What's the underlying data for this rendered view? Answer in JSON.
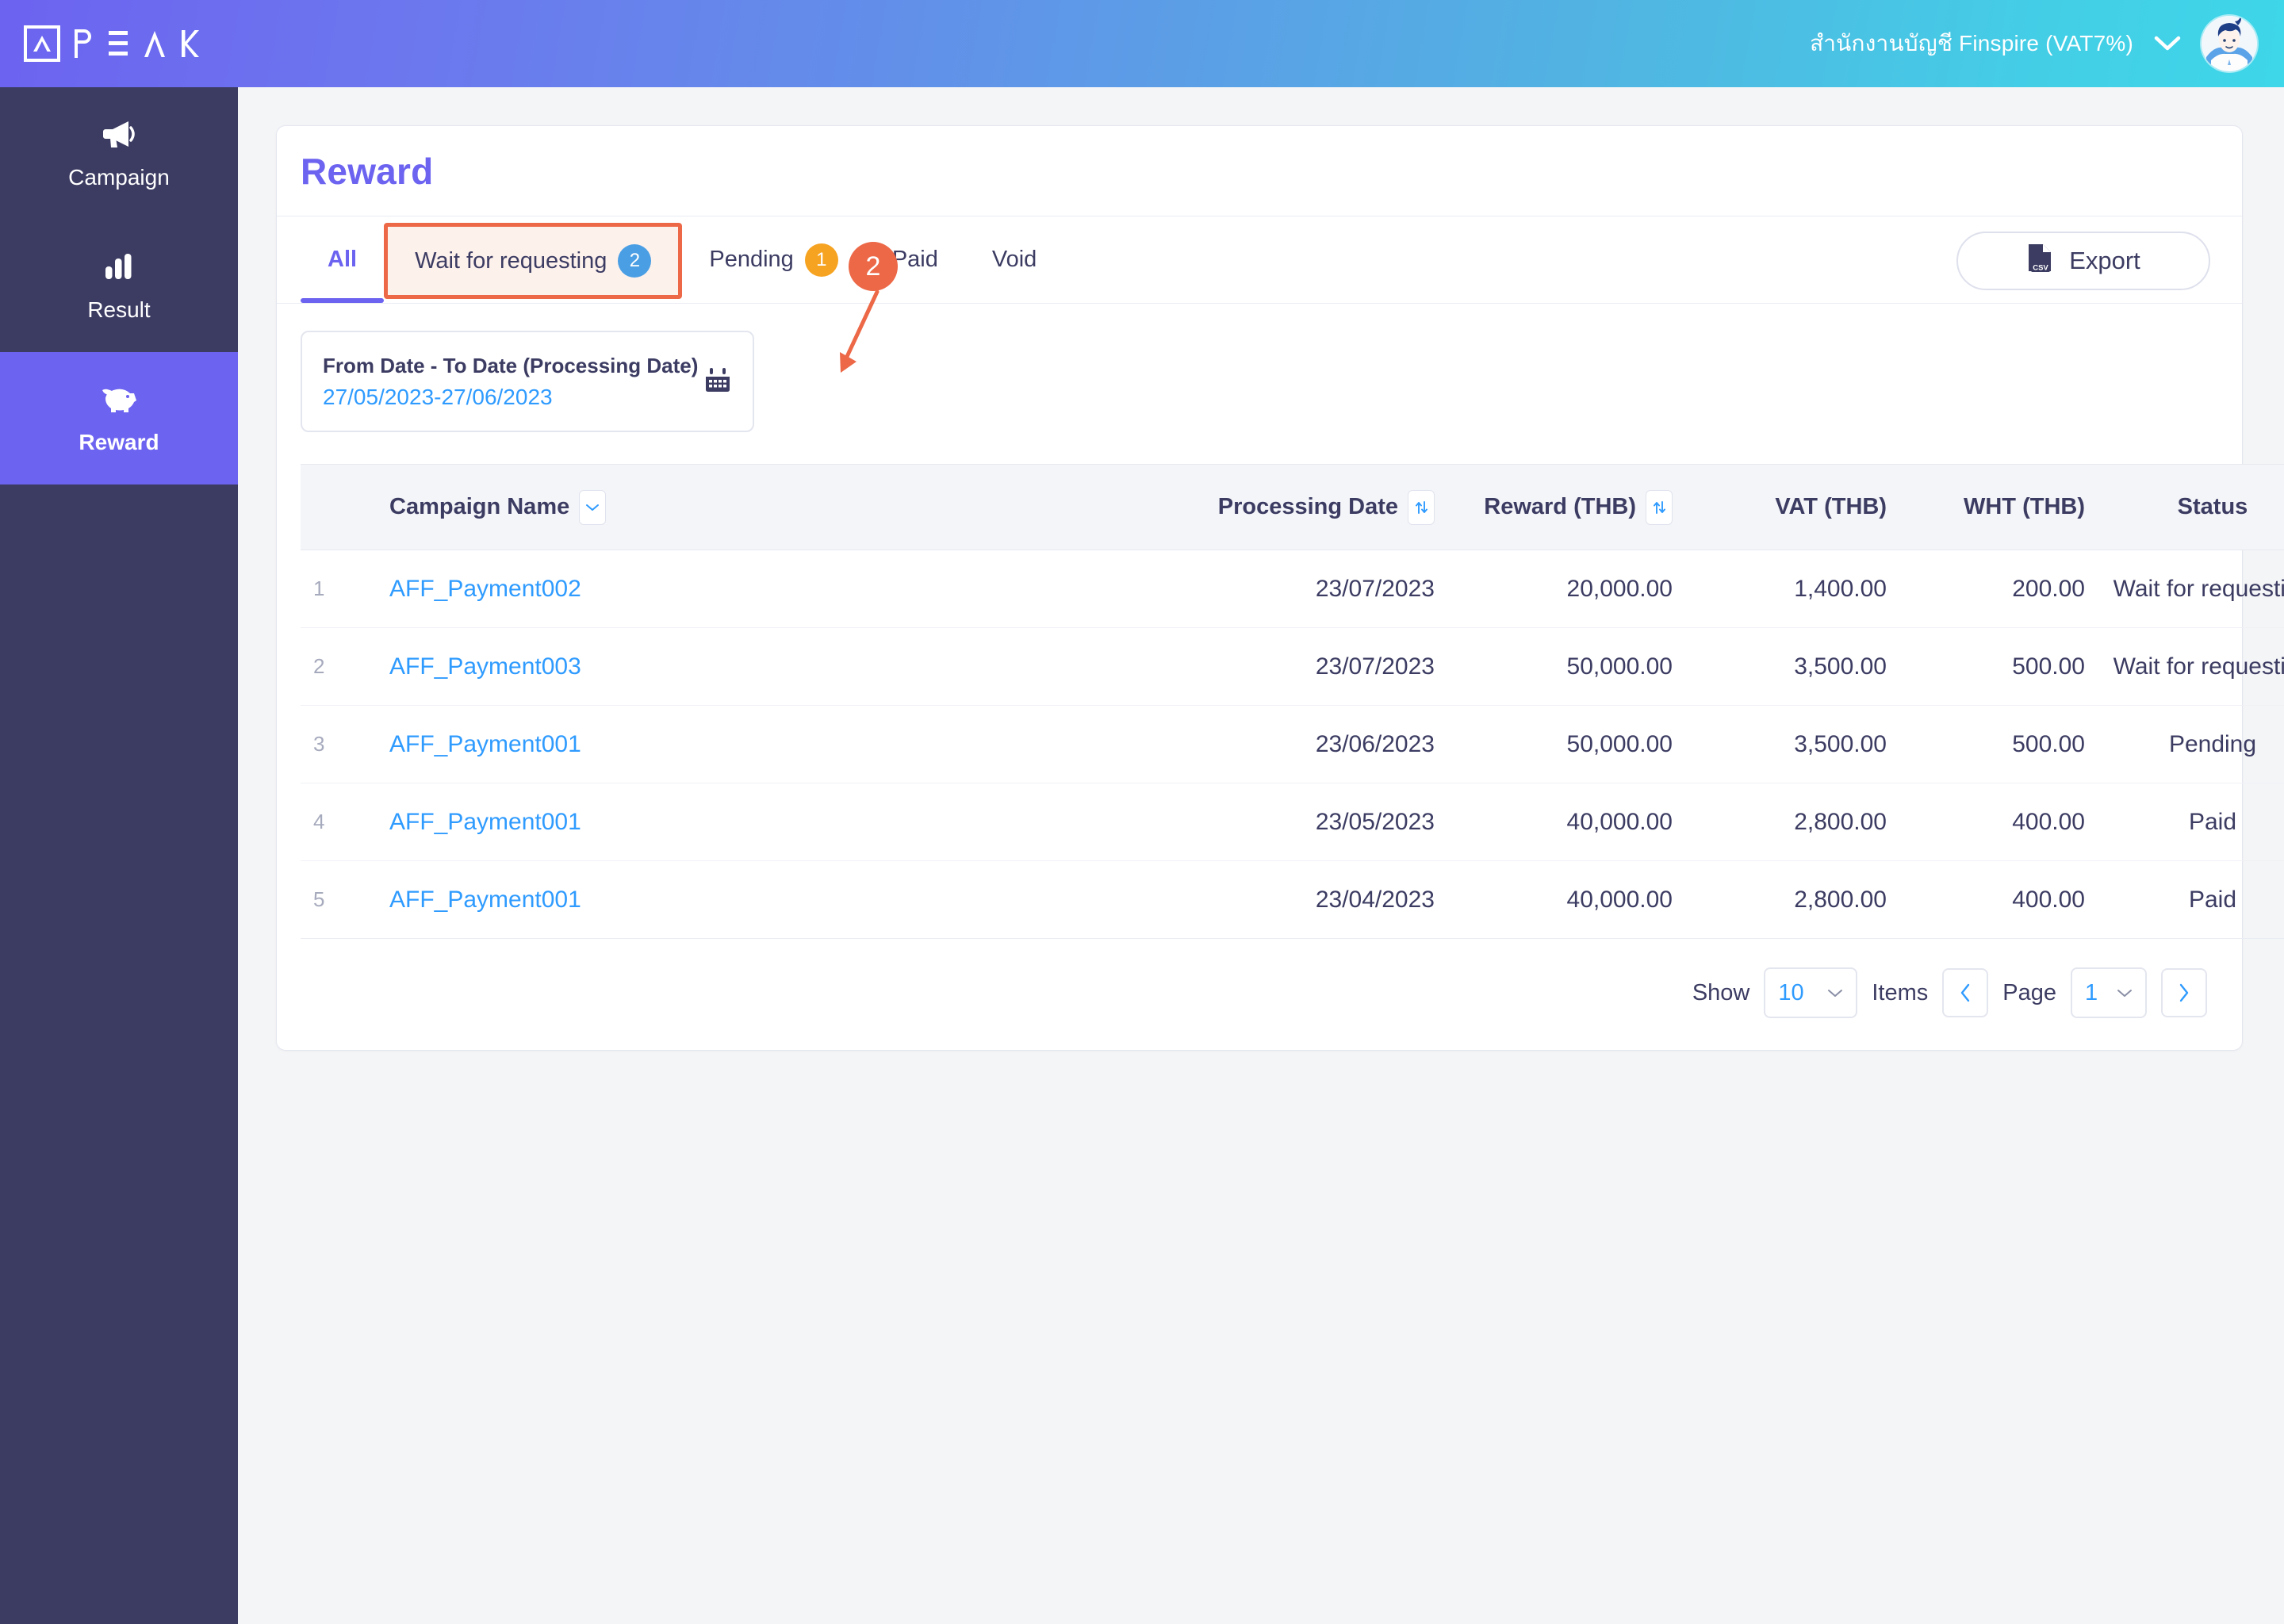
{
  "topbar": {
    "logo_text": "PEAK",
    "org_name": "สำนักงานบัญชี Finspire (VAT7%)",
    "caret_icon": "chevron-down-icon",
    "avatar_icon": "user-avatar"
  },
  "sidebar": {
    "items": [
      {
        "label": "Campaign",
        "icon": "megaphone-icon",
        "active": false
      },
      {
        "label": "Result",
        "icon": "bar-chart-icon",
        "active": false
      },
      {
        "label": "Reward",
        "icon": "piggy-bank-icon",
        "active": true
      }
    ]
  },
  "page": {
    "title": "Reward"
  },
  "tabs": [
    {
      "label": "All",
      "badge": "",
      "active": true,
      "highlighted": false
    },
    {
      "label": "Wait for requesting",
      "badge": "2",
      "badge_color": "#4A9FE4",
      "active": false,
      "highlighted": true
    },
    {
      "label": "Pending",
      "badge": "1",
      "badge_color": "#F6A321",
      "active": false,
      "highlighted": false
    },
    {
      "label": "Paid",
      "badge": "",
      "active": false,
      "highlighted": false
    },
    {
      "label": "Void",
      "badge": "",
      "active": false,
      "highlighted": false
    }
  ],
  "toolbar": {
    "export_label": "Export",
    "export_icon": "csv-file-icon"
  },
  "date_filter": {
    "label": "From Date - To Date (Processing Date)",
    "value": "27/05/2023-27/06/2023",
    "icon": "calendar-icon"
  },
  "table": {
    "columns": [
      {
        "key": "num",
        "label": ""
      },
      {
        "key": "name",
        "label": "Campaign Name",
        "control": "chevron-down-icon"
      },
      {
        "key": "date",
        "label": "Processing Date",
        "control": "sort-icon"
      },
      {
        "key": "reward",
        "label": "Reward (THB)",
        "control": "sort-icon"
      },
      {
        "key": "vat",
        "label": "VAT (THB)"
      },
      {
        "key": "wht",
        "label": "WHT (THB)"
      },
      {
        "key": "status",
        "label": "Status"
      }
    ],
    "rows": [
      {
        "num": "1",
        "name": "AFF_Payment002",
        "date": "23/07/2023",
        "reward": "20,000.00",
        "vat": "1,400.00",
        "wht": "200.00",
        "status": "Wait for requesting"
      },
      {
        "num": "2",
        "name": "AFF_Payment003",
        "date": "23/07/2023",
        "reward": "50,000.00",
        "vat": "3,500.00",
        "wht": "500.00",
        "status": "Wait for requesting"
      },
      {
        "num": "3",
        "name": "AFF_Payment001",
        "date": "23/06/2023",
        "reward": "50,000.00",
        "vat": "3,500.00",
        "wht": "500.00",
        "status": "Pending"
      },
      {
        "num": "4",
        "name": "AFF_Payment001",
        "date": "23/05/2023",
        "reward": "40,000.00",
        "vat": "2,800.00",
        "wht": "400.00",
        "status": "Paid"
      },
      {
        "num": "5",
        "name": "AFF_Payment001",
        "date": "23/04/2023",
        "reward": "40,000.00",
        "vat": "2,800.00",
        "wht": "400.00",
        "status": "Paid"
      }
    ]
  },
  "pagination": {
    "show_label": "Show",
    "items_label": "Items",
    "page_label": "Page",
    "rows_per_page": "10",
    "current_page": "1",
    "prev_icon": "chevron-left-icon",
    "next_icon": "chevron-right-icon"
  },
  "annotation": {
    "step_number": "2",
    "color": "#EC6847"
  },
  "colors": {
    "brand_purple": "#6C63F0",
    "sidebar": "#3C3C63",
    "link_blue": "#2F9BFF",
    "accent_orange": "#EC6847"
  }
}
